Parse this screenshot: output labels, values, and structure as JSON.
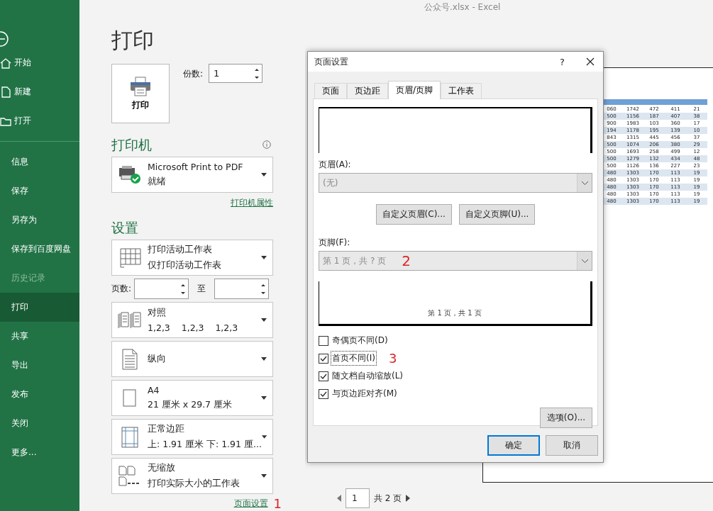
{
  "window": {
    "title": "公众号.xlsx  -  Excel"
  },
  "sidebar": {
    "top_items": [
      {
        "label": "开始",
        "kind": "home",
        "selected": false,
        "disabled": false
      },
      {
        "label": "新建",
        "kind": "new",
        "selected": false,
        "disabled": false
      },
      {
        "label": "打开",
        "kind": "open",
        "selected": false,
        "disabled": false
      }
    ],
    "items": [
      {
        "label": "信息",
        "selected": false,
        "disabled": false
      },
      {
        "label": "保存",
        "selected": false,
        "disabled": false
      },
      {
        "label": "另存为",
        "selected": false,
        "disabled": false
      },
      {
        "label": "保存到百度网盘",
        "selected": false,
        "disabled": false
      },
      {
        "label": "历史记录",
        "selected": false,
        "disabled": true
      },
      {
        "label": "打印",
        "selected": true,
        "disabled": false
      },
      {
        "label": "共享",
        "selected": false,
        "disabled": false
      },
      {
        "label": "导出",
        "selected": false,
        "disabled": false
      },
      {
        "label": "发布",
        "selected": false,
        "disabled": false
      },
      {
        "label": "关闭",
        "selected": false,
        "disabled": false
      },
      {
        "label": "更多...",
        "selected": false,
        "disabled": false
      }
    ]
  },
  "print_panel": {
    "title": "打印",
    "print_button": "打印",
    "copies_label": "份数:",
    "copies": "1",
    "printer_heading": "打印机",
    "printer": {
      "name": "Microsoft Print to PDF",
      "status": "就绪"
    },
    "printer_properties": "打印机属性",
    "settings_heading": "设置",
    "settings": [
      {
        "kind": "sheet",
        "line1": "打印活动工作表",
        "line2": "仅打印活动工作表"
      },
      {
        "kind": "pages",
        "label": "页数:",
        "to": "至"
      },
      {
        "kind": "collate",
        "line1": "对照",
        "line2": "1,2,3    1,2,3    1,2,3"
      },
      {
        "kind": "orientation",
        "line1": "纵向"
      },
      {
        "kind": "paper",
        "line1": "A4",
        "line2": "21 厘米 x 29.7 厘米"
      },
      {
        "kind": "margins",
        "line1": "正常边距",
        "line2": "上: 1.91 厘米 下: 1.91 厘..."
      },
      {
        "kind": "scaling",
        "line1": "无缩放",
        "line2": "打印实际大小的工作表"
      }
    ],
    "page_setup_link": "页面设置",
    "annotation": "1"
  },
  "preview": {
    "table_rows": [
      [
        "060",
        "1742",
        "472",
        "411",
        "21"
      ],
      [
        "500",
        "1156",
        "187",
        "407",
        "38"
      ],
      [
        "900",
        "1983",
        "103",
        "360",
        "17"
      ],
      [
        "194",
        "1178",
        "195",
        "139",
        "10"
      ],
      [
        "843",
        "1315",
        "445",
        "456",
        "37"
      ],
      [
        "500",
        "1074",
        "206",
        "380",
        "29"
      ],
      [
        "500",
        "1693",
        "258",
        "499",
        "12"
      ],
      [
        "500",
        "1279",
        "132",
        "434",
        "48"
      ],
      [
        "500",
        "1126",
        "136",
        "227",
        "23"
      ],
      [
        "480",
        "1303",
        "170",
        "113",
        "19"
      ],
      [
        "480",
        "1303",
        "170",
        "113",
        "19"
      ],
      [
        "480",
        "1303",
        "170",
        "113",
        "19"
      ],
      [
        "480",
        "1303",
        "170",
        "113",
        "19"
      ],
      [
        "480",
        "1303",
        "170",
        "113",
        "19"
      ]
    ],
    "page_number": "1",
    "page_count": "共 2 页"
  },
  "dialog": {
    "title": "页面设置",
    "help": "?",
    "tabs": [
      {
        "label": "页面",
        "selected": false
      },
      {
        "label": "页边距",
        "selected": false
      },
      {
        "label": "页眉/页脚",
        "selected": true
      },
      {
        "label": "工作表",
        "selected": false
      }
    ],
    "header_label": "页眉(A):",
    "header_value": "(无)",
    "header_disabled": true,
    "custom_header": "自定义页眉(C)...",
    "custom_footer": "自定义页脚(U)...",
    "footer_label": "页脚(F):",
    "footer_value": "第 1 页，共 ? 页",
    "footer_disabled": true,
    "footer_annotation": "2",
    "footer_preview": "第 1 页，共 1 页",
    "options": [
      {
        "label": "奇偶页不同(D)",
        "checked": false,
        "focused": false
      },
      {
        "label": "首页不同(I)",
        "checked": true,
        "focused": true,
        "annotation": "3"
      },
      {
        "label": "随文档自动缩放(L)",
        "checked": true,
        "focused": false
      },
      {
        "label": "与页边距对齐(M)",
        "checked": true,
        "focused": false
      }
    ],
    "options_button": "选项(O)...",
    "ok": "确定",
    "cancel": "取消"
  }
}
